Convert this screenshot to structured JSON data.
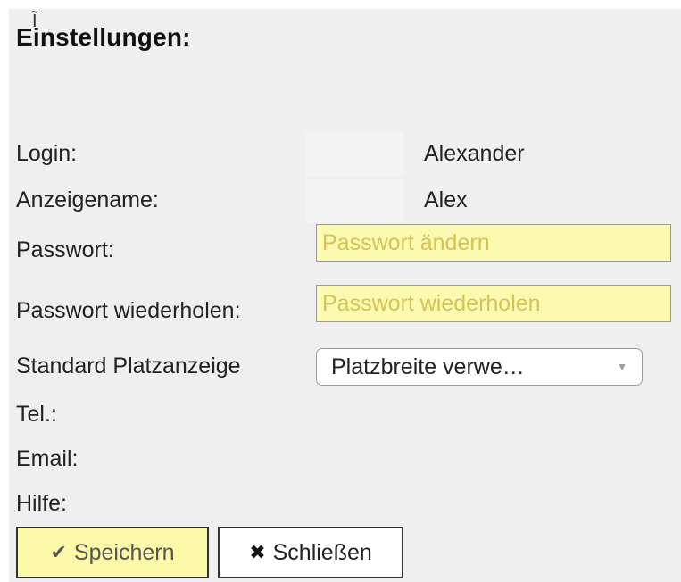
{
  "header": {
    "title": "Einstellungen:"
  },
  "fields": {
    "login": {
      "label": "Login:",
      "value": "Alexander"
    },
    "display_name": {
      "label": "Anzeigename:",
      "value": "Alex"
    },
    "password": {
      "label": "Passwort:",
      "placeholder": "Passwort ändern"
    },
    "password_repeat": {
      "label": "Passwort wiederholen:",
      "placeholder": "Passwort wiederholen"
    },
    "seat_display": {
      "label": "Standard Platzanzeige",
      "selected": "Platzbreite verwe…"
    },
    "phone": {
      "label": "Tel.:"
    },
    "email": {
      "label": "Email:"
    },
    "help": {
      "label": "Hilfe:"
    }
  },
  "actions": {
    "save": {
      "label": "Speichern",
      "icon": "check-icon"
    },
    "close": {
      "label": "Schließen",
      "icon": "x-icon"
    }
  },
  "colors": {
    "panel_bg": "#efefef",
    "input_highlight": "#fcfab0",
    "placeholder": "#d6c257"
  }
}
